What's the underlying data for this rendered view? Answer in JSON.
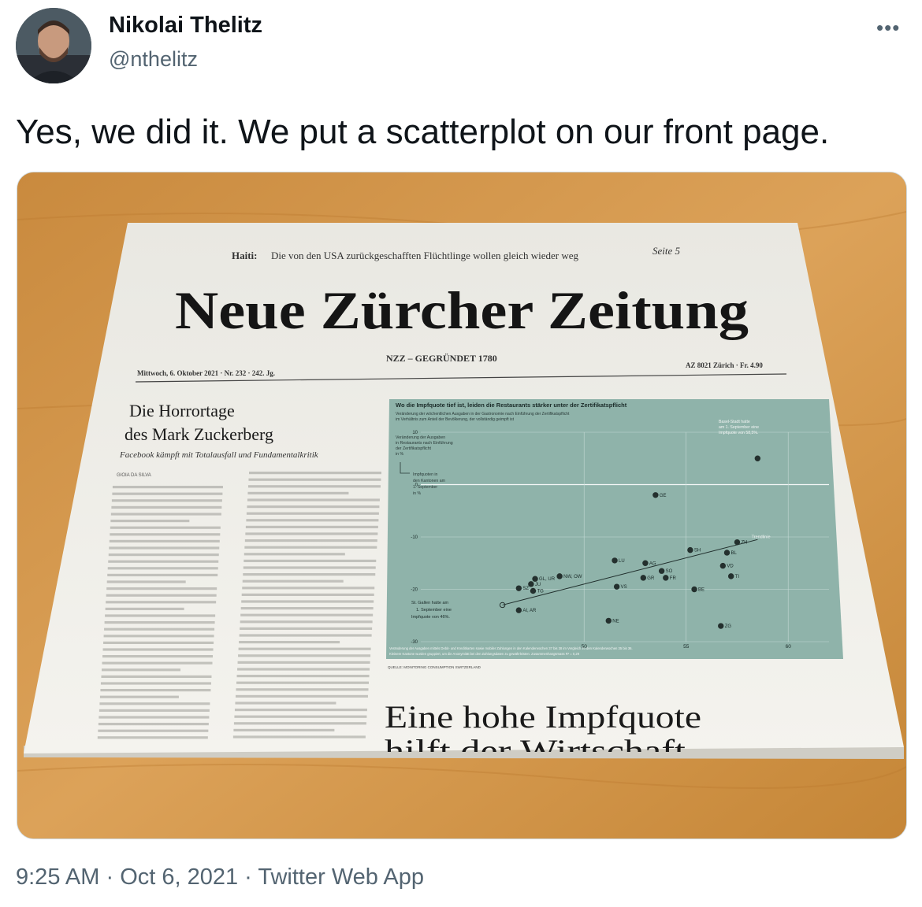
{
  "author": {
    "display_name": "Nikolai Thelitz",
    "handle": "@nthelitz",
    "avatar_icon": "profile-photo"
  },
  "more_menu": {
    "icon": "more-horizontal-icon",
    "glyph": "•••"
  },
  "tweet": {
    "text": "Yes, we did it. We put a scatterplot on our front page."
  },
  "meta": {
    "time": "9:25 AM",
    "sep1": " · ",
    "date": "Oct 6, 2021",
    "sep2": " · ",
    "source": "Twitter Web App"
  },
  "newspaper": {
    "teaser_label": "Haiti:",
    "teaser_text": "Die von den USA zurückgeschafften Flüchtlinge wollen gleich wieder weg",
    "teaser_page": "Seite 5",
    "masthead": "Neue Zürcher Zeitung",
    "founded": "NZZ – GEGRÜNDET 1780",
    "dateline_left": "Mittwoch, 6. Oktober 2021  ·  Nr. 232  ·  242. Jg.",
    "dateline_right": "AZ 8021 Zürich  ·  Fr. 4.90",
    "article_headline_1": "Die Horrortage",
    "article_headline_2": "des Mark Zuckerberg",
    "article_subhead": "Facebook kämpft mit Totalausfall und Fundamentalkritik",
    "article_byline": "GIOIA DA SILVA",
    "bottom_headline_1": "Eine hohe Impfquote",
    "bottom_headline_2": "hilft der Wirtschaft"
  },
  "chart_data": {
    "type": "scatter",
    "title": "Wo die Impfquote tief ist, leiden die Restaurants stärker unter der Zertifikatspflicht",
    "subtitle_1": "Veränderung der wöchentlichen Ausgaben in der Gastronomie nach Einführung der Zertifikatspflicht",
    "subtitle_2": "im Verhältnis zum Anteil der Bevölkerung, der vollständig geimpft ist",
    "ylabel_1": "Veränderung der Ausgaben",
    "ylabel_2": "in Restaurants nach Einführung",
    "ylabel_3": "der Zertifikatspflicht",
    "ylabel_4": "in %",
    "xlabel_1": "Impfquoten in",
    "xlabel_2": "den Kantonen am",
    "xlabel_3": "1. September",
    "xlabel_4": "in %",
    "annotation_basel_1": "Basel-Stadt hatte",
    "annotation_basel_2": "am 1. September eine",
    "annotation_basel_3": "Impfquote von 58,5%.",
    "annotation_sg_1": "St. Gallen hatte am",
    "annotation_sg_2": "1. September eine",
    "annotation_sg_3": "Impfquote von 46%.",
    "trend_label": "Trendlinie",
    "footnote_1": "Veränderung der Ausgaben mittels Debit- und Kreditkarten sowie mobiler Zahlungen in den Kalenderwochen 37 bis 38 im Vergleich zu den Kalenderwochen 35 bis 36.",
    "footnote_2": "Kleinere Kantone wurden gruppiert, um die Anonymität bei den Zahlungsdaten zu gewährleisten. Zusammenhangsmass R² = 0,29",
    "source": "QUELLE: MONITORING CONSUMPTION SWITZERLAND",
    "xticks": [
      50,
      55,
      60
    ],
    "yticks": [
      10,
      0,
      -10,
      -20,
      -30
    ],
    "xlim": [
      42,
      62
    ],
    "ylim": [
      -30,
      10
    ],
    "points": [
      {
        "label": "GE",
        "x": 53.5,
        "y": -2
      },
      {
        "label": "ZH",
        "x": 57.5,
        "y": -11
      },
      {
        "label": "SH",
        "x": 55.2,
        "y": -12.5
      },
      {
        "label": "BL",
        "x": 57,
        "y": -13
      },
      {
        "label": "LU",
        "x": 51.5,
        "y": -14.5
      },
      {
        "label": "AG",
        "x": 53,
        "y": -15
      },
      {
        "label": "VD",
        "x": 56.8,
        "y": -15.5
      },
      {
        "label": "SO",
        "x": 53.8,
        "y": -16.5
      },
      {
        "label": "NW, OW",
        "x": 48.8,
        "y": -17.5
      },
      {
        "label": "TI",
        "x": 57.2,
        "y": -17.5
      },
      {
        "label": "GL, UR",
        "x": 47.6,
        "y": -18
      },
      {
        "label": "GR",
        "x": 52.9,
        "y": -17.8
      },
      {
        "label": "FR",
        "x": 54,
        "y": -17.8
      },
      {
        "label": "JU",
        "x": 47.4,
        "y": -19
      },
      {
        "label": "SZ",
        "x": 46.8,
        "y": -19.8
      },
      {
        "label": "VS",
        "x": 51.6,
        "y": -19.5
      },
      {
        "label": "TG",
        "x": 47.5,
        "y": -20.3
      },
      {
        "label": "BE",
        "x": 55.4,
        "y": -20
      },
      {
        "label": "SG",
        "x": 46,
        "y": -23
      },
      {
        "label": "AI, AR",
        "x": 46.8,
        "y": -24
      },
      {
        "label": "NE",
        "x": 51.2,
        "y": -26
      },
      {
        "label": "ZG",
        "x": 56.7,
        "y": -27
      },
      {
        "label": "BS",
        "x": 58.5,
        "y": 5
      }
    ]
  }
}
